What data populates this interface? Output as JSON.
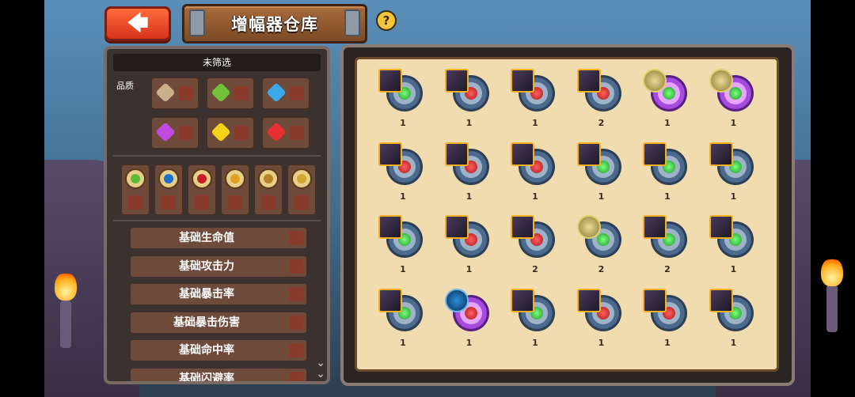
{
  "header": {
    "back_label": "🡄",
    "title": "增幅器仓库",
    "help_label": "?"
  },
  "filter": {
    "heading": "未筛选",
    "quality_label": "品质",
    "quality_colors": [
      "#c9b08a",
      "#6fc23a",
      "#3aa8e8",
      "#c04ae0",
      "#f4d21a",
      "#e83030"
    ],
    "types": [
      {
        "icon": "green-leaf-icon",
        "color": "#5dbb3a"
      },
      {
        "icon": "blue-eye-icon",
        "color": "#1a6fd0"
      },
      {
        "icon": "red-swirl-icon",
        "color": "#c81e28"
      },
      {
        "icon": "golden-helmet-icon",
        "color": "#e0a020"
      },
      {
        "icon": "scroll-icon",
        "color": "#b8862a"
      },
      {
        "icon": "spiral-icon",
        "color": "#d0a830"
      }
    ],
    "stats": [
      "基础生命值",
      "基础攻击力",
      "基础暴击率",
      "基础暴击伤害",
      "基础命中率",
      "基础闪避率"
    ]
  },
  "inventory": {
    "items": [
      {
        "qty": "1",
        "frame": "blue",
        "core": "green",
        "portrait": "square"
      },
      {
        "qty": "1",
        "frame": "blue",
        "core": "red",
        "portrait": "square"
      },
      {
        "qty": "1",
        "frame": "blue",
        "core": "red",
        "portrait": "square"
      },
      {
        "qty": "2",
        "frame": "blue",
        "core": "red",
        "portrait": "square"
      },
      {
        "qty": "1",
        "frame": "purple",
        "core": "green",
        "portrait": "round"
      },
      {
        "qty": "1",
        "frame": "purple",
        "core": "green",
        "portrait": "round"
      },
      {
        "qty": "1",
        "frame": "blue",
        "core": "red",
        "portrait": "square"
      },
      {
        "qty": "1",
        "frame": "blue",
        "core": "red",
        "portrait": "square"
      },
      {
        "qty": "1",
        "frame": "blue",
        "core": "red",
        "portrait": "square"
      },
      {
        "qty": "1",
        "frame": "blue",
        "core": "green",
        "portrait": "square"
      },
      {
        "qty": "1",
        "frame": "blue",
        "core": "green",
        "portrait": "square"
      },
      {
        "qty": "1",
        "frame": "blue",
        "core": "green",
        "portrait": "square"
      },
      {
        "qty": "1",
        "frame": "blue",
        "core": "green",
        "portrait": "square"
      },
      {
        "qty": "1",
        "frame": "blue",
        "core": "red",
        "portrait": "square"
      },
      {
        "qty": "2",
        "frame": "blue",
        "core": "red",
        "portrait": "square"
      },
      {
        "qty": "2",
        "frame": "blue",
        "core": "green",
        "portrait": "round"
      },
      {
        "qty": "2",
        "frame": "blue",
        "core": "green",
        "portrait": "square"
      },
      {
        "qty": "1",
        "frame": "blue",
        "core": "green",
        "portrait": "square"
      },
      {
        "qty": "1",
        "frame": "blue",
        "core": "green",
        "portrait": "square"
      },
      {
        "qty": "1",
        "frame": "purple",
        "core": "red",
        "portrait": "rdark"
      },
      {
        "qty": "1",
        "frame": "blue",
        "core": "green",
        "portrait": "square"
      },
      {
        "qty": "1",
        "frame": "blue",
        "core": "red",
        "portrait": "square"
      },
      {
        "qty": "1",
        "frame": "blue",
        "core": "red",
        "portrait": "square"
      },
      {
        "qty": "1",
        "frame": "blue",
        "core": "green",
        "portrait": "square"
      }
    ]
  }
}
